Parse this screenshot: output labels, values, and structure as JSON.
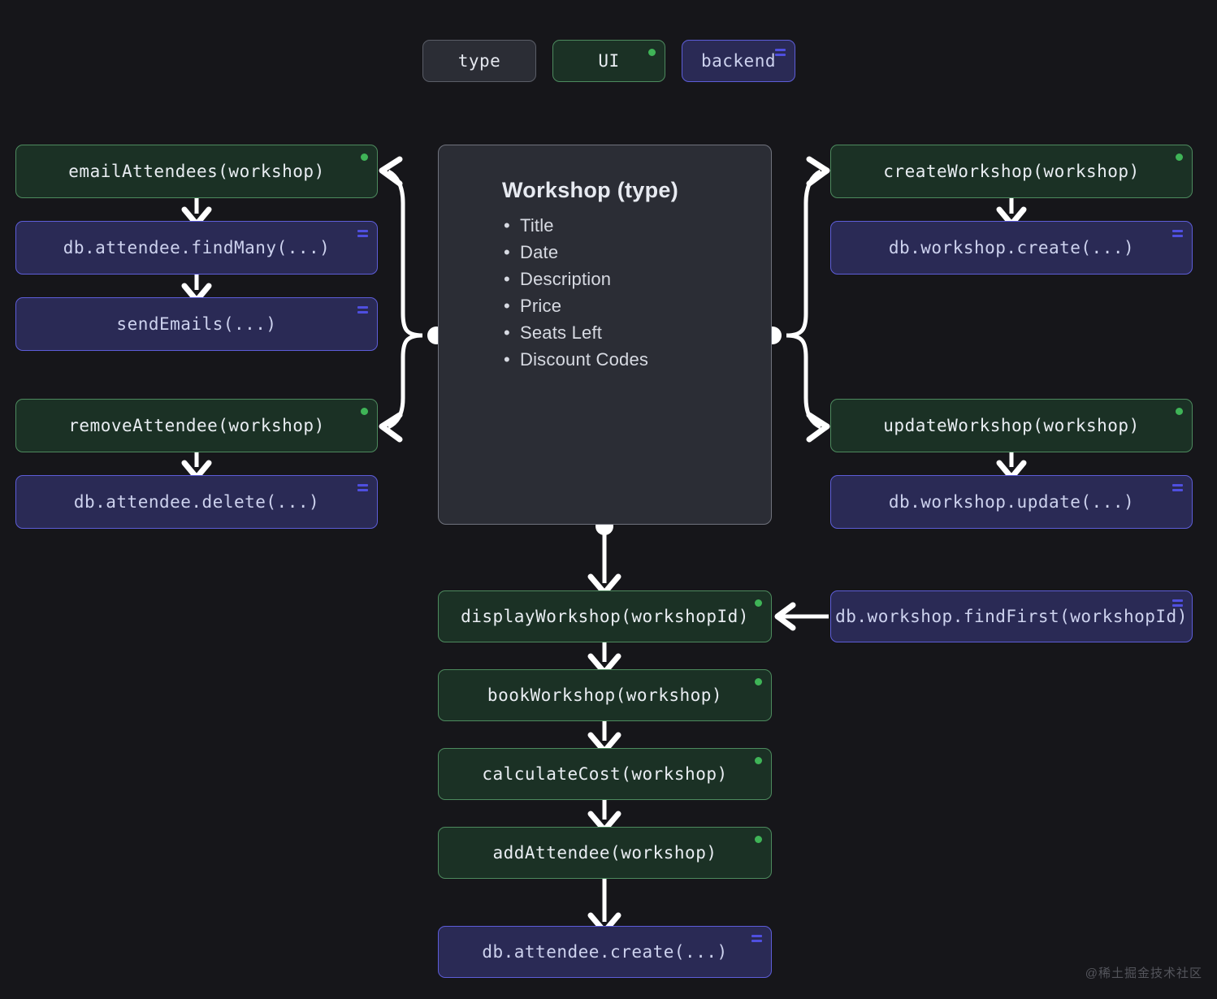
{
  "page": {
    "background": "#16161a",
    "watermark": "@稀土掘金技术社区"
  },
  "legend": {
    "items": [
      {
        "label": "type",
        "kind": "type",
        "badge": "none"
      },
      {
        "label": "UI",
        "kind": "ui",
        "badge": "green-dot"
      },
      {
        "label": "backend",
        "kind": "backend",
        "badge": "blue-bars"
      }
    ],
    "colors": {
      "type_fill": "#2b2d35",
      "type_border": "#5a5d67",
      "ui_fill": "#1b3125",
      "ui_border": "#4d8a5e",
      "ui_dot": "#3fb457",
      "backend_fill": "#2a2a55",
      "backend_border": "#5d5dd8",
      "backend_bars": "#4f4fe0"
    }
  },
  "type_card": {
    "title": "Workshop (type)",
    "fields": [
      "Title",
      "Date",
      "Description",
      "Price",
      "Seats Left",
      "Discount Codes"
    ]
  },
  "nodes": {
    "email_attendees": {
      "label": "emailAttendees(workshop)",
      "kind": "ui"
    },
    "db_attendee_find_many": {
      "label": "db.attendee.findMany(...)",
      "kind": "backend"
    },
    "send_emails": {
      "label": "sendEmails(...)",
      "kind": "backend"
    },
    "remove_attendee": {
      "label": "removeAttendee(workshop)",
      "kind": "ui"
    },
    "db_attendee_delete": {
      "label": "db.attendee.delete(...)",
      "kind": "backend"
    },
    "create_workshop": {
      "label": "createWorkshop(workshop)",
      "kind": "ui"
    },
    "db_workshop_create": {
      "label": "db.workshop.create(...)",
      "kind": "backend"
    },
    "update_workshop": {
      "label": "updateWorkshop(workshop)",
      "kind": "ui"
    },
    "db_workshop_update": {
      "label": "db.workshop.update(...)",
      "kind": "backend"
    },
    "display_workshop": {
      "label": "displayWorkshop(workshopId)",
      "kind": "ui"
    },
    "db_workshop_find_first": {
      "label": "db.workshop.findFirst(workshopId)",
      "kind": "backend"
    },
    "book_workshop": {
      "label": "bookWorkshop(workshop)",
      "kind": "ui"
    },
    "calculate_cost": {
      "label": "calculateCost(workshop)",
      "kind": "ui"
    },
    "add_attendee": {
      "label": "addAttendee(workshop)",
      "kind": "ui"
    },
    "db_attendee_create": {
      "label": "db.attendee.create(...)",
      "kind": "backend"
    }
  }
}
